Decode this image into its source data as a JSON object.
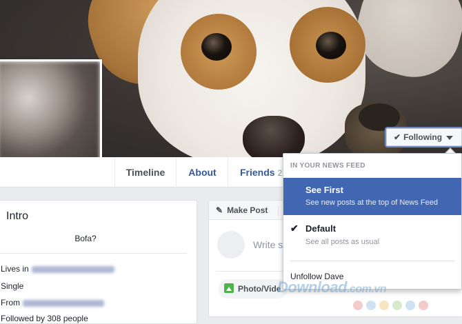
{
  "nav": {
    "tabs": [
      {
        "label": "Timeline"
      },
      {
        "label": "About"
      },
      {
        "label": "Friends",
        "count": "2"
      }
    ]
  },
  "follow_button": {
    "label": "Following",
    "icon": "check-icon"
  },
  "dropdown": {
    "section_label": "IN YOUR NEWS FEED",
    "options": [
      {
        "title": "See First",
        "subtitle": "See new posts at the top of News Feed",
        "selected_style": "highlighted"
      },
      {
        "title": "Default",
        "subtitle": "See all posts as usual",
        "checked": true
      }
    ],
    "unfollow_label": "Unfollow Dave"
  },
  "intro": {
    "title": "Intro",
    "bio": "Bofa?",
    "rows": [
      {
        "prefix": "Lives in"
      },
      {
        "prefix": "Single"
      },
      {
        "prefix": "From"
      },
      {
        "prefix": "Followed by 308 people"
      }
    ]
  },
  "composer": {
    "make_post_label": "Make Post",
    "placeholder": "Write s",
    "photo_video_label": "Photo/Vide"
  },
  "watermark": {
    "text": "Download",
    "suffix": ".com.vn"
  },
  "colors": {
    "accent": "#4267b2",
    "link": "#365899",
    "page_bg": "#e9ebee",
    "watermark_dots": [
      "#e7a0a0",
      "#a9c9e6",
      "#f0d090",
      "#b5dba0",
      "#a9c9e6",
      "#e7a0a0"
    ]
  }
}
